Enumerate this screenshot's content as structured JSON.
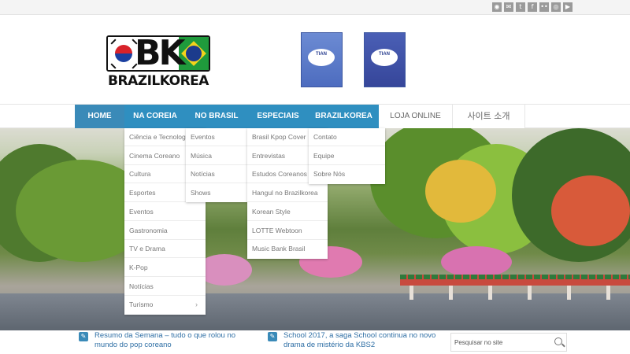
{
  "social_icons": [
    {
      "name": "rss-icon",
      "glyph": "◉"
    },
    {
      "name": "email-icon",
      "glyph": "✉"
    },
    {
      "name": "twitter-icon",
      "glyph": "t"
    },
    {
      "name": "facebook-icon",
      "glyph": "f"
    },
    {
      "name": "flickr-icon",
      "glyph": "••"
    },
    {
      "name": "instagram-icon",
      "glyph": "◎"
    },
    {
      "name": "youtube-icon",
      "glyph": "▶"
    }
  ],
  "logo": {
    "mark": "BK",
    "text": "BRAZILKOREA"
  },
  "covers": [
    {
      "title": "TIAN"
    },
    {
      "title": "TIAN"
    }
  ],
  "nav": {
    "items": [
      {
        "label": "HOME"
      },
      {
        "label": "NA COREIA"
      },
      {
        "label": "NO BRASIL"
      },
      {
        "label": "ESPECIAIS"
      },
      {
        "label": "BRAZILKOREA"
      },
      {
        "label": "LOJA ONLINE"
      },
      {
        "label": "사이트 소개"
      }
    ]
  },
  "menus": {
    "na_coreia": [
      "Ciência e Tecnologia",
      "Cinema Coreano",
      "Cultura",
      "Esportes",
      "Eventos",
      "Gastronomia",
      "TV e Drama",
      "K-Pop",
      "Notícias",
      "Turismo"
    ],
    "na_coreia_arrow": "›",
    "no_brasil": [
      "Eventos",
      "Música",
      "Notícias",
      "Shows"
    ],
    "especiais": [
      "Brasil Kpop Cover",
      "Entrevistas",
      "Estudos Coreanos",
      "Hangul no Brazilkorea",
      "Korean Style",
      "LOTTE Webtoon",
      "Music Bank Brasil"
    ],
    "brazilkorea": [
      "Contato",
      "Equipe",
      "Sobre Nós"
    ]
  },
  "news": [
    {
      "text": "Resumo da Semana – tudo o que rolou no mundo do pop coreano"
    },
    {
      "text": "School 2017, a saga School continua no novo drama de mistério da KBS2"
    }
  ],
  "search": {
    "placeholder": "Pesquisar no site"
  }
}
